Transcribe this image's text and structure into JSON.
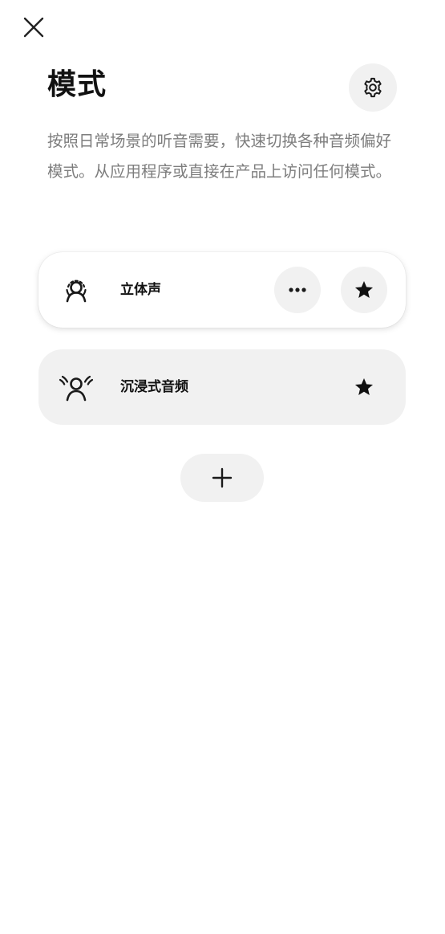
{
  "header": {
    "close_icon": "close-icon",
    "title": "模式",
    "settings_icon": "gear-icon"
  },
  "description": "按照日常场景的听音需要，快速切换各种音频偏好模式。从应用程序或直接在产品上访问任何模式。",
  "modes": [
    {
      "label": "立体声",
      "icon": "stereo-person-icon",
      "active": true,
      "more_icon": "more-horizontal-icon",
      "favorite_icon": "star-icon"
    },
    {
      "label": "沉浸式音频",
      "icon": "immersive-audio-person-icon",
      "active": false,
      "favorite_icon": "star-icon"
    }
  ],
  "add_button": {
    "icon": "plus-icon"
  }
}
